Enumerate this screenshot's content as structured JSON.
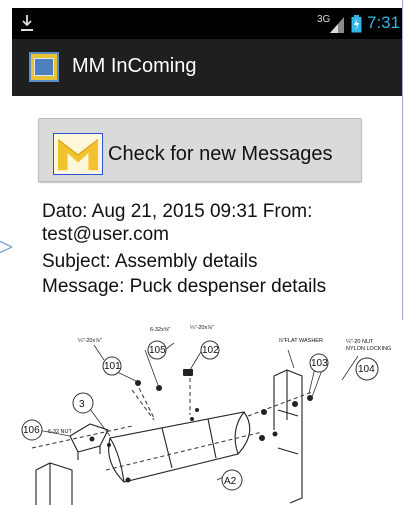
{
  "status_bar": {
    "network": "3G",
    "time": "7:31"
  },
  "app": {
    "title": "MM InComing"
  },
  "actions": {
    "check_label": "Check for new Messages"
  },
  "message": {
    "line1": "Dato: Aug 21, 2015 09:31 From:",
    "line2": "test@user.com",
    "subject": "Subject: Assembly details",
    "body": "Message: Puck despenser details"
  },
  "drawing": {
    "labels": {
      "c101": "101",
      "c105": "105",
      "c102": "102",
      "c103": "103",
      "c104": "104",
      "c3": "3",
      "c106": "106",
      "a2": "A2",
      "s1": "¼\"-20x⅞\"",
      "s2": "6-32x⅝\"",
      "s3": "¼\"-20x⅞\"",
      "s4": "⅞\"FLAT WASHER",
      "s5": "¼\"-20 NUT",
      "s6": "NYLON LOCKING",
      "s7": "6-32 NUT"
    }
  },
  "colors": {
    "status_bar": "#000000",
    "action_bar": "#1f1f1f",
    "clock": "#33b5e5",
    "button": "#dadada"
  }
}
